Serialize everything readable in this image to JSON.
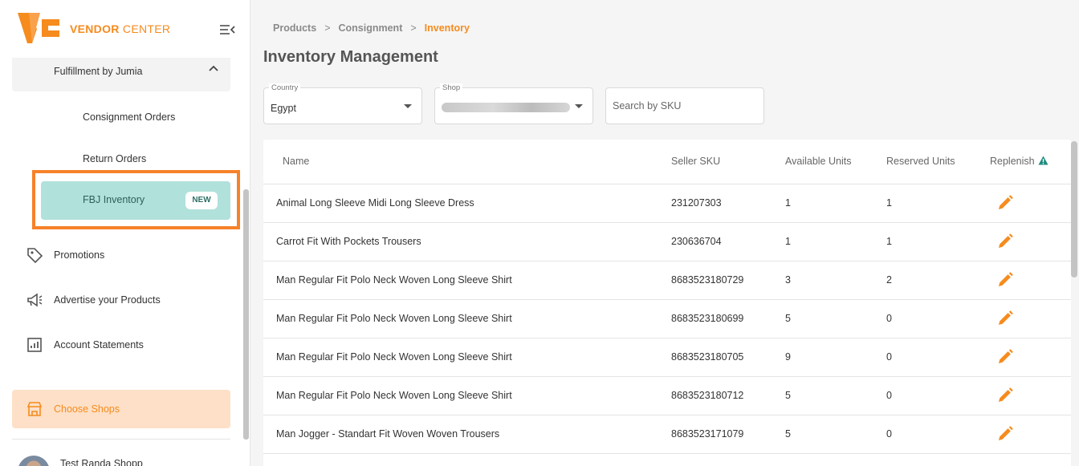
{
  "brand": {
    "part1": "VENDOR",
    "part2": "CENTER"
  },
  "sidebar": {
    "group_label": "Fulfillment by Jumia",
    "sub_items": [
      "Consignment Orders",
      "Return Orders"
    ],
    "active_item": {
      "label": "FBJ Inventory",
      "badge": "NEW"
    },
    "nav_items": [
      {
        "label": "Promotions",
        "icon": "tag-icon"
      },
      {
        "label": "Advertise your Products",
        "icon": "megaphone-icon"
      },
      {
        "label": "Account Statements",
        "icon": "chart-icon"
      }
    ],
    "choose_shops": "Choose Shops",
    "user_name": "Test Randa Shopp"
  },
  "breadcrumb": [
    "Products",
    "Consignment",
    "Inventory"
  ],
  "breadcrumb_sep": ">",
  "page_title": "Inventory Management",
  "filters": {
    "country": {
      "label": "Country",
      "value": "Egypt"
    },
    "shop": {
      "label": "Shop"
    },
    "search": {
      "placeholder": "Search by SKU"
    }
  },
  "table": {
    "columns": [
      "Name",
      "Seller SKU",
      "Available Units",
      "Reserved Units",
      "Replenish"
    ],
    "rows": [
      {
        "name": "Animal Long Sleeve Midi Long Sleeve Dress",
        "sku": "231207303",
        "available": "1",
        "reserved": "1"
      },
      {
        "name": "Carrot Fit With Pockets Trousers",
        "sku": "230636704",
        "available": "1",
        "reserved": "1"
      },
      {
        "name": "Man Regular Fit Polo Neck Woven Long Sleeve Shirt",
        "sku": "8683523180729",
        "available": "3",
        "reserved": "2"
      },
      {
        "name": "Man Regular Fit Polo Neck Woven Long Sleeve Shirt",
        "sku": "8683523180699",
        "available": "5",
        "reserved": "0"
      },
      {
        "name": "Man Regular Fit Polo Neck Woven Long Sleeve Shirt",
        "sku": "8683523180705",
        "available": "9",
        "reserved": "0"
      },
      {
        "name": "Man Regular Fit Polo Neck Woven Long Sleeve Shirt",
        "sku": "8683523180712",
        "available": "5",
        "reserved": "0"
      },
      {
        "name": "Man Jogger - Standart Fit Woven Woven Trousers",
        "sku": "8683523171079",
        "available": "5",
        "reserved": "0"
      }
    ]
  },
  "colors": {
    "accent": "#f68b1e",
    "active_bg": "#b1e1db",
    "warning_icon": "#1f8a7f",
    "highlight_frame": "#f6822a"
  }
}
